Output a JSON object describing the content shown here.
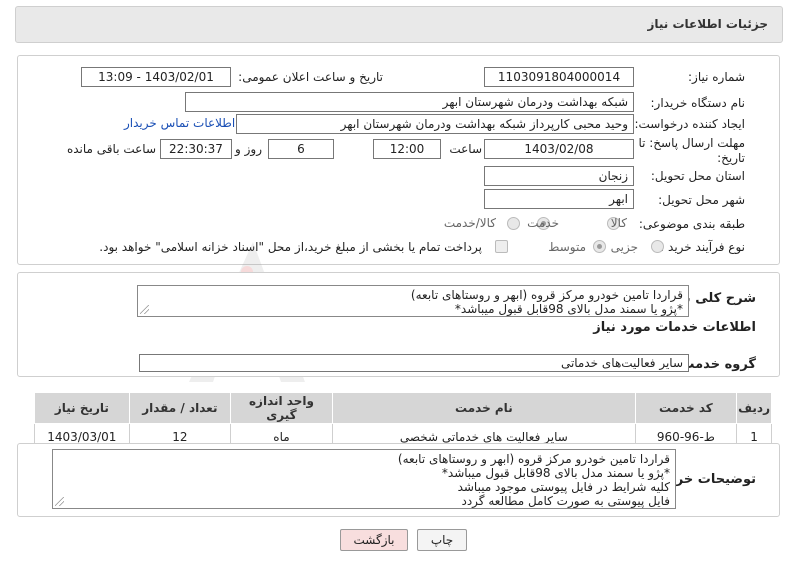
{
  "header": {
    "title": "جزئیات اطلاعات نیاز"
  },
  "form": {
    "need_number_label": "شماره نیاز:",
    "need_number": "1103091804000014",
    "announce_label": "تاریخ و ساعت اعلان عمومی:",
    "announce_value": "1403/02/01 - 13:09",
    "buyer_org_label": "نام دستگاه خریدار:",
    "buyer_org": "شبکه بهداشت ودرمان شهرستان ابهر",
    "creator_label": "ایجاد کننده درخواست:",
    "creator": "وحید محبی کارپرداز شبکه بهداشت ودرمان شهرستان ابهر",
    "contact_link": "اطلاعات تماس خریدار",
    "deadline_label_1": "مهلت ارسال پاسخ: تا",
    "deadline_label_2": "تاریخ:",
    "deadline_date": "1403/02/08",
    "time_label": "ساعت",
    "deadline_time": "12:00",
    "days_value": "6",
    "days_label": "روز و",
    "remaining_time": "22:30:37",
    "remaining_label": "ساعت باقی مانده",
    "province_label": "استان محل تحویل:",
    "province": "زنجان",
    "city_label": "شهر محل تحویل:",
    "city": "ابهر",
    "category_label": "طبقه بندی موضوعی:",
    "category_options": [
      "کالا",
      "خدمت",
      "کالا/خدمت"
    ],
    "category_selected": "خدمت",
    "process_label": "نوع فرآیند خرید :",
    "process_options": [
      "جزیی",
      "متوسط"
    ],
    "process_selected": "متوسط",
    "payment_note": "پرداخت تمام یا بخشی از مبلغ خرید،از محل \"اسناد خزانه اسلامی\" خواهد بود."
  },
  "summary": {
    "label": "شرح کلی نیاز:",
    "lines": [
      "قراردا تامین خودرو مرکز قروه (ابهر و روستاهای تابعه)",
      "*پژو یا سمند مدل بالای 98قابل قبول میباشد*"
    ]
  },
  "services": {
    "section_title": "اطلاعات خدمات مورد نیاز",
    "group_label": "گروه خدمت:",
    "group_value": "سایر فعالیت‌های خدماتی",
    "columns": [
      "ردیف",
      "کد خدمت",
      "نام خدمت",
      "واحد اندازه گیری",
      "تعداد / مقدار",
      "تاریخ نیاز"
    ],
    "rows": [
      [
        "1",
        "ط-96-960",
        "سایر فعالیت های خدماتی شخصی",
        "ماه",
        "12",
        "1403/03/01"
      ]
    ]
  },
  "buyer_notes": {
    "label": "توضیحات خریدار:",
    "lines": [
      "قراردا تامین خودرو مرکز قروه (ابهر و روستاهای تابعه)",
      "*پژو یا سمند مدل بالای 98قابل قبول میباشد*",
      "کلیه شرایط در فایل پیوستی موجود میباشد",
      "فایل پیوستی به صورت کامل مطالعه گردد"
    ]
  },
  "buttons": {
    "print": "چاپ",
    "back": "بازگشت"
  },
  "watermark": {
    "text": "AriaTender.neT"
  },
  "colors": {
    "link": "#1a4fb5",
    "back_button_bg": "#f8dede",
    "header_bg": "#e9e9e9"
  }
}
